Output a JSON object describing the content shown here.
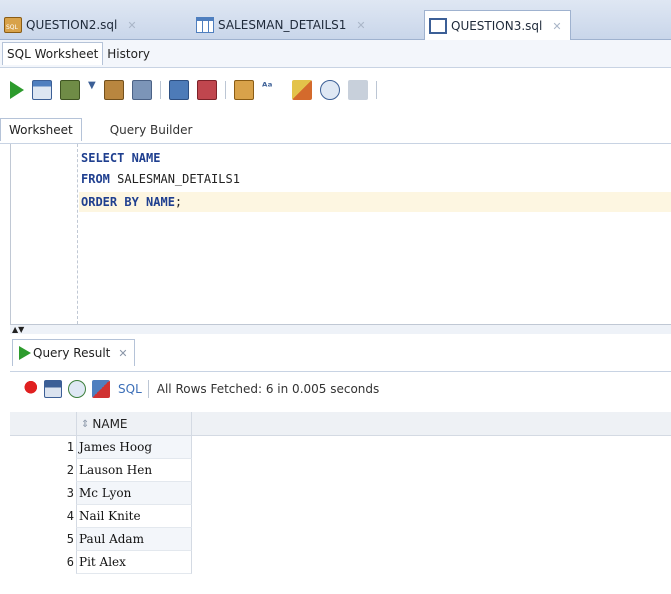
{
  "editor_tabs": [
    {
      "label": "QUESTION2.sql",
      "icon": "sql-file-icon"
    },
    {
      "label": "SALESMAN_DETAILS1",
      "icon": "table-icon"
    },
    {
      "label": "QUESTION3.sql",
      "icon": "worksheet-icon"
    }
  ],
  "sub_tabs": [
    "SQL Worksheet",
    "History"
  ],
  "worksheet_tabs": [
    "Worksheet",
    "Query Builder"
  ],
  "code": {
    "line1_kw": "SELECT NAME",
    "line2_kw": "FROM",
    "line2_rest": " SALESMAN_DETAILS1",
    "line3_kw": "ORDER BY NAME",
    "line3_rest": ";"
  },
  "result": {
    "tab_label": "Query Result",
    "sql_link": "SQL",
    "status": "All Rows Fetched: 6 in 0.005 seconds",
    "column": "NAME",
    "rows": [
      {
        "n": "1",
        "name": "James Hoog"
      },
      {
        "n": "2",
        "name": "Lauson Hen"
      },
      {
        "n": "3",
        "name": "Mc Lyon"
      },
      {
        "n": "4",
        "name": "Nail Knite"
      },
      {
        "n": "5",
        "name": "Paul Adam"
      },
      {
        "n": "6",
        "name": "Pit Alex"
      }
    ]
  },
  "colors": {
    "accent": "#2d9b2d",
    "keyword": "#1f3f8f",
    "link": "#3c6fb8"
  }
}
